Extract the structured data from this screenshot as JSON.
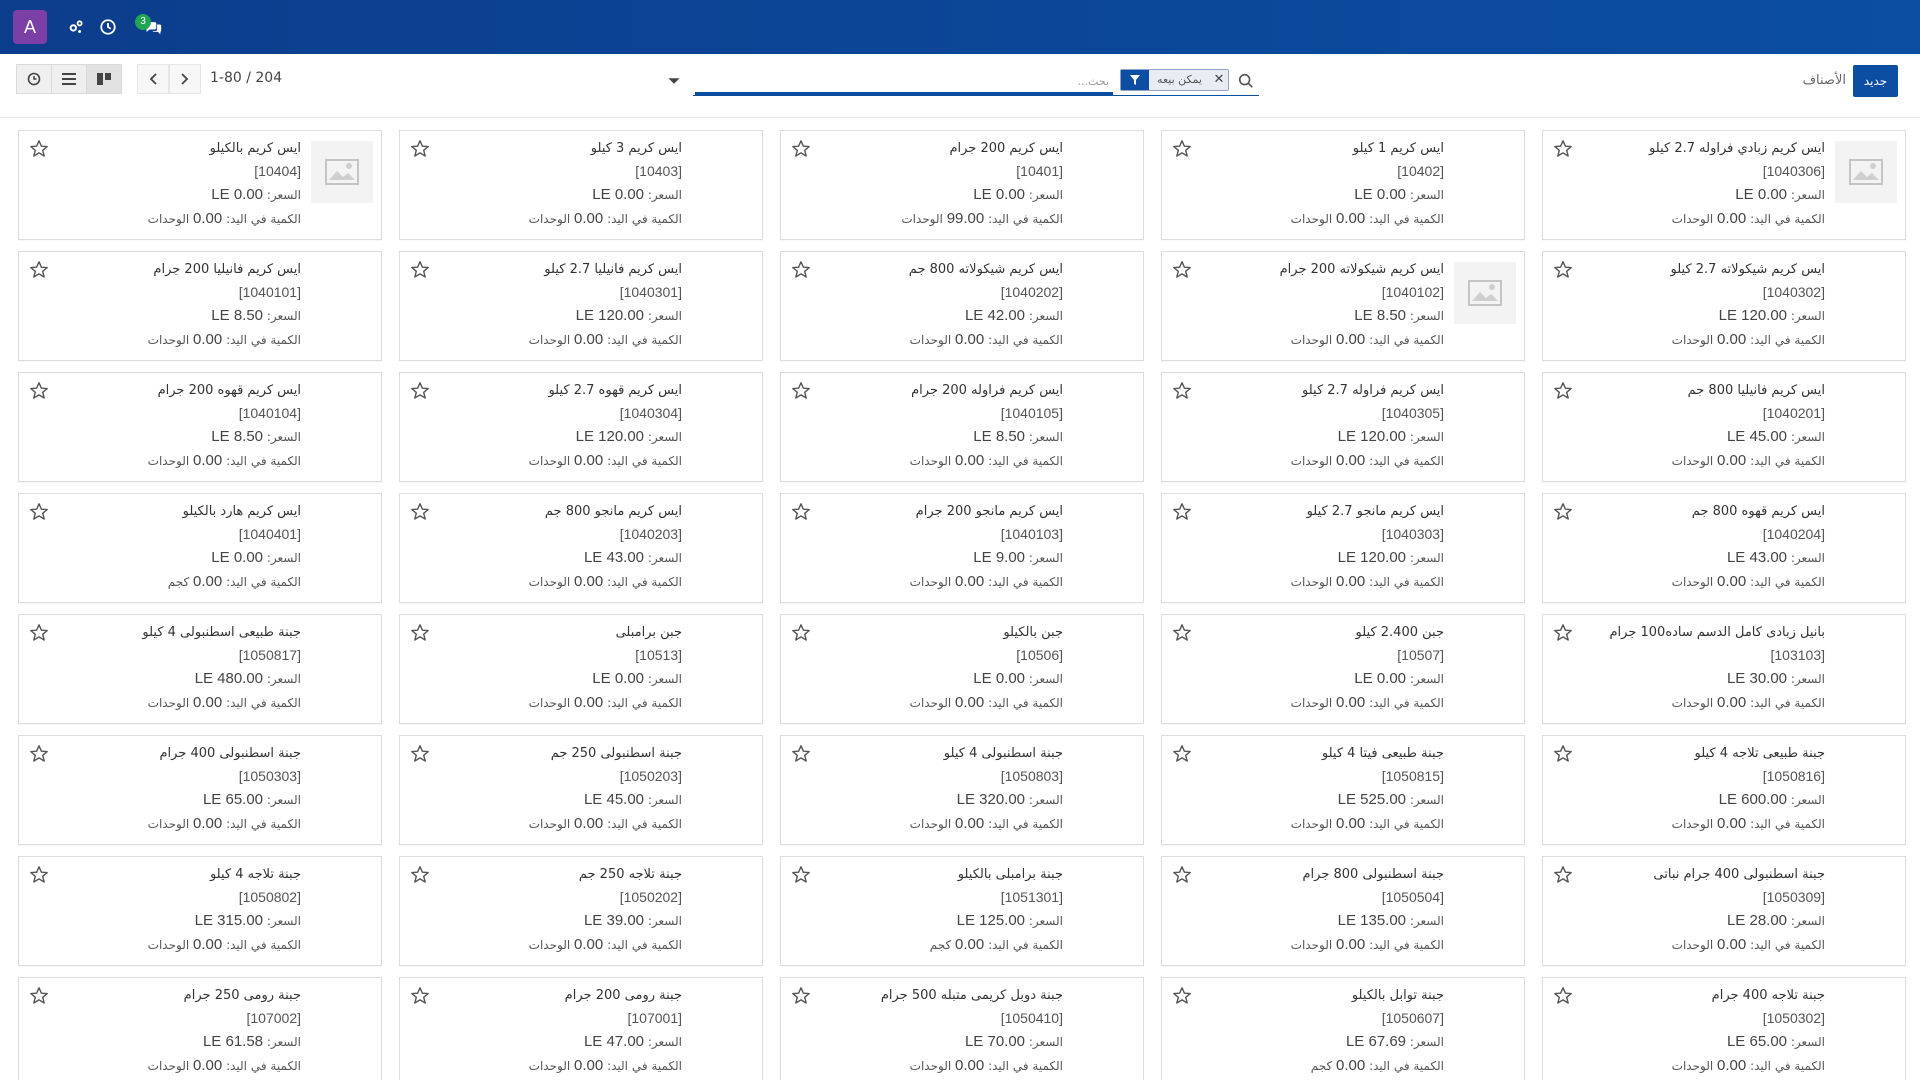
{
  "navbar": {
    "avatar_letter": "A",
    "chat_badge": "3",
    "icons": [
      "settings-icon",
      "clock-icon",
      "chat-icon"
    ]
  },
  "control": {
    "new_label": "جديد",
    "breadcrumb": "الأصناف",
    "filter_facet": "يمكن بيعه",
    "search_placeholder": "بحث...",
    "pager": "1-80 / 204"
  },
  "labels": {
    "price_prefix": "السعر: ",
    "qty_prefix": "الكمية في اليد: "
  },
  "colors": {
    "navbar": "#0b4ea2",
    "accent": "#0b4ea2",
    "avatar": "#7b3fa6",
    "badge": "#23a455"
  },
  "products": [
    {
      "name": "ايس كريم زبادي فراوله 2.7 كيلو",
      "code": "[1040306]",
      "price": "0.00 LE",
      "qty": "0.00",
      "unit": "الوحدات",
      "image": true
    },
    {
      "name": "ايس كريم 1 كيلو",
      "code": "[10402]",
      "price": "0.00 LE",
      "qty": "0.00",
      "unit": "الوحدات",
      "image": false
    },
    {
      "name": "ايس كريم 200 جرام",
      "code": "[10401]",
      "price": "0.00 LE",
      "qty": "99.00",
      "unit": "الوحدات",
      "image": false
    },
    {
      "name": "ايس كريم 3 كيلو",
      "code": "[10403]",
      "price": "0.00 LE",
      "qty": "0.00",
      "unit": "الوحدات",
      "image": false
    },
    {
      "name": "ايس كريم بالكيلو",
      "code": "[10404]",
      "price": "0.00 LE",
      "qty": "0.00",
      "unit": "الوحدات",
      "image": true
    },
    {
      "name": "ايس كريم شيكولاته 2.7 كيلو",
      "code": "[1040302]",
      "price": "120.00 LE",
      "qty": "0.00",
      "unit": "الوحدات",
      "image": false
    },
    {
      "name": "ايس كريم شيكولاته 200 جرام",
      "code": "[1040102]",
      "price": "8.50 LE",
      "qty": "0.00",
      "unit": "الوحدات",
      "image": true
    },
    {
      "name": "ايس كريم شيكولاته 800 جم",
      "code": "[1040202]",
      "price": "42.00 LE",
      "qty": "0.00",
      "unit": "الوحدات",
      "image": false
    },
    {
      "name": "ايس كريم فانيليا 2.7 كيلو",
      "code": "[1040301]",
      "price": "120.00 LE",
      "qty": "0.00",
      "unit": "الوحدات",
      "image": false
    },
    {
      "name": "ايس كريم فانيليا 200 جرام",
      "code": "[1040101]",
      "price": "8.50 LE",
      "qty": "0.00",
      "unit": "الوحدات",
      "image": false
    },
    {
      "name": "ايس كريم فانيليا 800 جم",
      "code": "[1040201]",
      "price": "45.00 LE",
      "qty": "0.00",
      "unit": "الوحدات",
      "image": false
    },
    {
      "name": "ايس كريم فراوله 2.7 كيلو",
      "code": "[1040305]",
      "price": "120.00 LE",
      "qty": "0.00",
      "unit": "الوحدات",
      "image": false
    },
    {
      "name": "ايس كريم فراوله 200 جرام",
      "code": "[1040105]",
      "price": "8.50 LE",
      "qty": "0.00",
      "unit": "الوحدات",
      "image": false
    },
    {
      "name": "ايس كريم قهوه 2.7 كيلو",
      "code": "[1040304]",
      "price": "120.00 LE",
      "qty": "0.00",
      "unit": "الوحدات",
      "image": false
    },
    {
      "name": "ايس كريم قهوه 200 جرام",
      "code": "[1040104]",
      "price": "8.50 LE",
      "qty": "0.00",
      "unit": "الوحدات",
      "image": false
    },
    {
      "name": "ايس كريم قهوه 800 جم",
      "code": "[1040204]",
      "price": "43.00 LE",
      "qty": "0.00",
      "unit": "الوحدات",
      "image": false
    },
    {
      "name": "ايس كريم مانجو 2.7 كيلو",
      "code": "[1040303]",
      "price": "120.00 LE",
      "qty": "0.00",
      "unit": "الوحدات",
      "image": false
    },
    {
      "name": "ايس كريم مانجو 200 جرام",
      "code": "[1040103]",
      "price": "9.00 LE",
      "qty": "0.00",
      "unit": "الوحدات",
      "image": false
    },
    {
      "name": "ايس كريم مانجو 800 جم",
      "code": "[1040203]",
      "price": "43.00 LE",
      "qty": "0.00",
      "unit": "الوحدات",
      "image": false
    },
    {
      "name": "ايس كريم هارد بالكيلو",
      "code": "[1040401]",
      "price": "0.00 LE",
      "qty": "0.00",
      "unit": "كجم",
      "image": false
    },
    {
      "name": "بانيل زبادى كامل الدسم ساده100 جرام",
      "code": "[103103]",
      "price": "30.00 LE",
      "qty": "0.00",
      "unit": "الوحدات",
      "image": false
    },
    {
      "name": "جبن 2.400 كيلو",
      "code": "[10507]",
      "price": "0.00 LE",
      "qty": "0.00",
      "unit": "الوحدات",
      "image": false
    },
    {
      "name": "جبن بالكيلو",
      "code": "[10506]",
      "price": "0.00 LE",
      "qty": "0.00",
      "unit": "الوحدات",
      "image": false
    },
    {
      "name": "جبن برامبلى",
      "code": "[10513]",
      "price": "0.00 LE",
      "qty": "0.00",
      "unit": "الوحدات",
      "image": false
    },
    {
      "name": "جبنة طبيعى اسطنبولى 4 كيلو",
      "code": "[1050817]",
      "price": "480.00 LE",
      "qty": "0.00",
      "unit": "الوحدات",
      "image": false
    },
    {
      "name": "جبنة طبيعى تلاجه 4 كيلو",
      "code": "[1050816]",
      "price": "600.00 LE",
      "qty": "0.00",
      "unit": "الوحدات",
      "image": false
    },
    {
      "name": "جبنة طبيعى فيتا 4 كيلو",
      "code": "[1050815]",
      "price": "525.00 LE",
      "qty": "0.00",
      "unit": "الوحدات",
      "image": false
    },
    {
      "name": "جبنة اسطنبولى 4 كيلو",
      "code": "[1050803]",
      "price": "320.00 LE",
      "qty": "0.00",
      "unit": "الوحدات",
      "image": false
    },
    {
      "name": "جبنة اسطنبولى 250 جم",
      "code": "[1050203]",
      "price": "45.00 LE",
      "qty": "0.00",
      "unit": "الوحدات",
      "image": false
    },
    {
      "name": "جبنة اسطنبولى 400 جرام",
      "code": "[1050303]",
      "price": "65.00 LE",
      "qty": "0.00",
      "unit": "الوحدات",
      "image": false
    },
    {
      "name": "جبنة اسطنبولى 400 جرام نباتى",
      "code": "[1050309]",
      "price": "28.00 LE",
      "qty": "0.00",
      "unit": "الوحدات",
      "image": false
    },
    {
      "name": "جبنة اسطنبولى 800 جرام",
      "code": "[1050504]",
      "price": "135.00 LE",
      "qty": "0.00",
      "unit": "الوحدات",
      "image": false
    },
    {
      "name": "جبنة برامبلى بالكيلو",
      "code": "[1051301]",
      "price": "125.00 LE",
      "qty": "0.00",
      "unit": "كجم",
      "image": false
    },
    {
      "name": "جبنة تلاجه 250 جم",
      "code": "[1050202]",
      "price": "39.00 LE",
      "qty": "0.00",
      "unit": "الوحدات",
      "image": false
    },
    {
      "name": "جبنة تلاجه 4 كيلو",
      "code": "[1050802]",
      "price": "315.00 LE",
      "qty": "0.00",
      "unit": "الوحدات",
      "image": false
    },
    {
      "name": "جبنة تلاجه 400 جرام",
      "code": "[1050302]",
      "price": "65.00 LE",
      "qty": "0.00",
      "unit": "الوحدات",
      "image": false
    },
    {
      "name": "جبنة توابل بالكيلو",
      "code": "[1050607]",
      "price": "67.69 LE",
      "qty": "0.00",
      "unit": "كجم",
      "image": false
    },
    {
      "name": "جبنة دوبل كريمى متبله 500 جرام",
      "code": "[1050410]",
      "price": "70.00 LE",
      "qty": "0.00",
      "unit": "الوحدات",
      "image": false
    },
    {
      "name": "جبنة رومى 200 جرام",
      "code": "[107001]",
      "price": "47.00 LE",
      "qty": "0.00",
      "unit": "الوحدات",
      "image": false
    },
    {
      "name": "جبنة رومى 250 جرام",
      "code": "[107002]",
      "price": "61.58 LE",
      "qty": "0.00",
      "unit": "الوحدات",
      "image": false
    }
  ]
}
